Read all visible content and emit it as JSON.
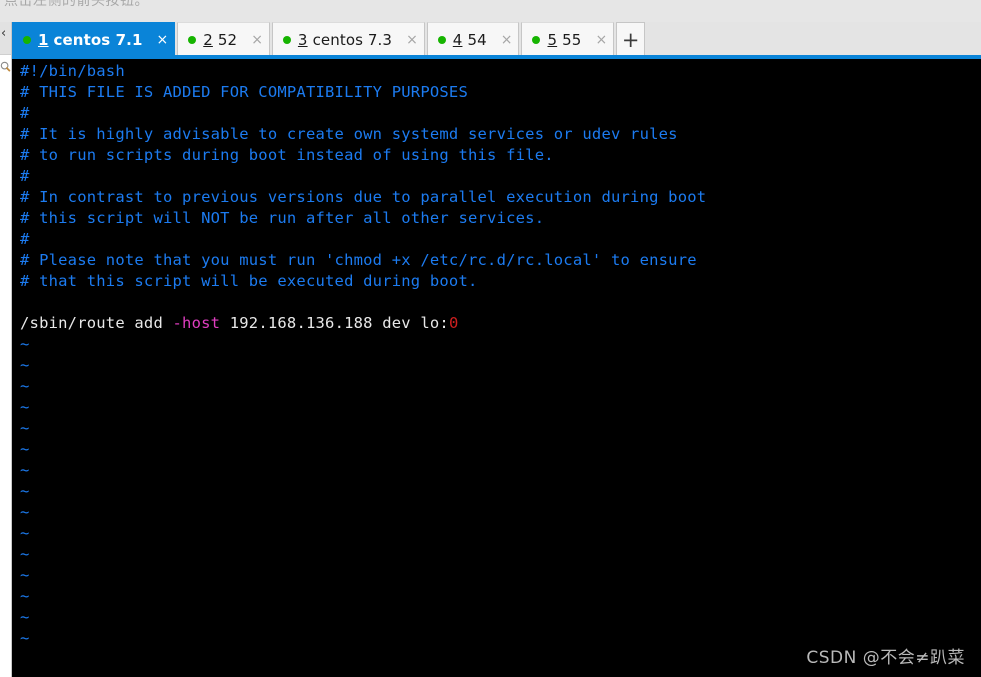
{
  "top_hint": {
    "text": "点击左侧的箭头按钮。"
  },
  "left_rail": {
    "collapse_label": "‹",
    "search_icon_name": "search-icon"
  },
  "tabbar": {
    "add_label": "+",
    "close_label": "×",
    "active_index": 0,
    "accent_color": "#0a84d8",
    "dot_color": "#16b400",
    "tabs": [
      {
        "mnemonic": "1",
        "title": "centos 7.1",
        "active": true
      },
      {
        "mnemonic": "2",
        "title": "52",
        "active": false
      },
      {
        "mnemonic": "3",
        "title": "centos 7.3",
        "active": false
      },
      {
        "mnemonic": "4",
        "title": "54",
        "active": false
      },
      {
        "mnemonic": "5",
        "title": "55",
        "active": false
      }
    ]
  },
  "terminal": {
    "background": "#000000",
    "comment_color": "#1c7bf0",
    "text_color": "#e8e8e8",
    "flag_color": "#e03ec0",
    "number_color": "#cf1f1f",
    "lines": [
      {
        "type": "comment",
        "text": "#!/bin/bash"
      },
      {
        "type": "comment",
        "text": "# THIS FILE IS ADDED FOR COMPATIBILITY PURPOSES"
      },
      {
        "type": "comment",
        "text": "#"
      },
      {
        "type": "comment",
        "text": "# It is highly advisable to create own systemd services or udev rules"
      },
      {
        "type": "comment",
        "text": "# to run scripts during boot instead of using this file."
      },
      {
        "type": "comment",
        "text": "#"
      },
      {
        "type": "comment",
        "text": "# In contrast to previous versions due to parallel execution during boot"
      },
      {
        "type": "comment",
        "text": "# this script will NOT be run after all other services."
      },
      {
        "type": "comment",
        "text": "#"
      },
      {
        "type": "comment",
        "text": "# Please note that you must run 'chmod +x /etc/rc.d/rc.local' to ensure"
      },
      {
        "type": "comment",
        "text": "# that this script will be executed during boot."
      },
      {
        "type": "blank",
        "text": ""
      },
      {
        "type": "command",
        "segments": [
          {
            "cls": "c-plain",
            "text": "/sbin/route add "
          },
          {
            "cls": "c-flag",
            "text": "-host"
          },
          {
            "cls": "c-plain",
            "text": " 192.168.136.188 dev lo:"
          },
          {
            "cls": "c-num",
            "text": "0"
          }
        ]
      },
      {
        "type": "tilde",
        "text": "~"
      },
      {
        "type": "tilde",
        "text": "~"
      },
      {
        "type": "tilde",
        "text": "~"
      },
      {
        "type": "tilde",
        "text": "~"
      },
      {
        "type": "tilde",
        "text": "~"
      },
      {
        "type": "tilde",
        "text": "~"
      },
      {
        "type": "tilde",
        "text": "~"
      },
      {
        "type": "tilde",
        "text": "~"
      },
      {
        "type": "tilde",
        "text": "~"
      },
      {
        "type": "tilde",
        "text": "~"
      },
      {
        "type": "tilde",
        "text": "~"
      },
      {
        "type": "tilde",
        "text": "~"
      },
      {
        "type": "tilde",
        "text": "~"
      },
      {
        "type": "tilde",
        "text": "~"
      },
      {
        "type": "tilde",
        "text": "~"
      }
    ]
  },
  "watermark": {
    "text": "CSDN @不会≠趴菜"
  }
}
